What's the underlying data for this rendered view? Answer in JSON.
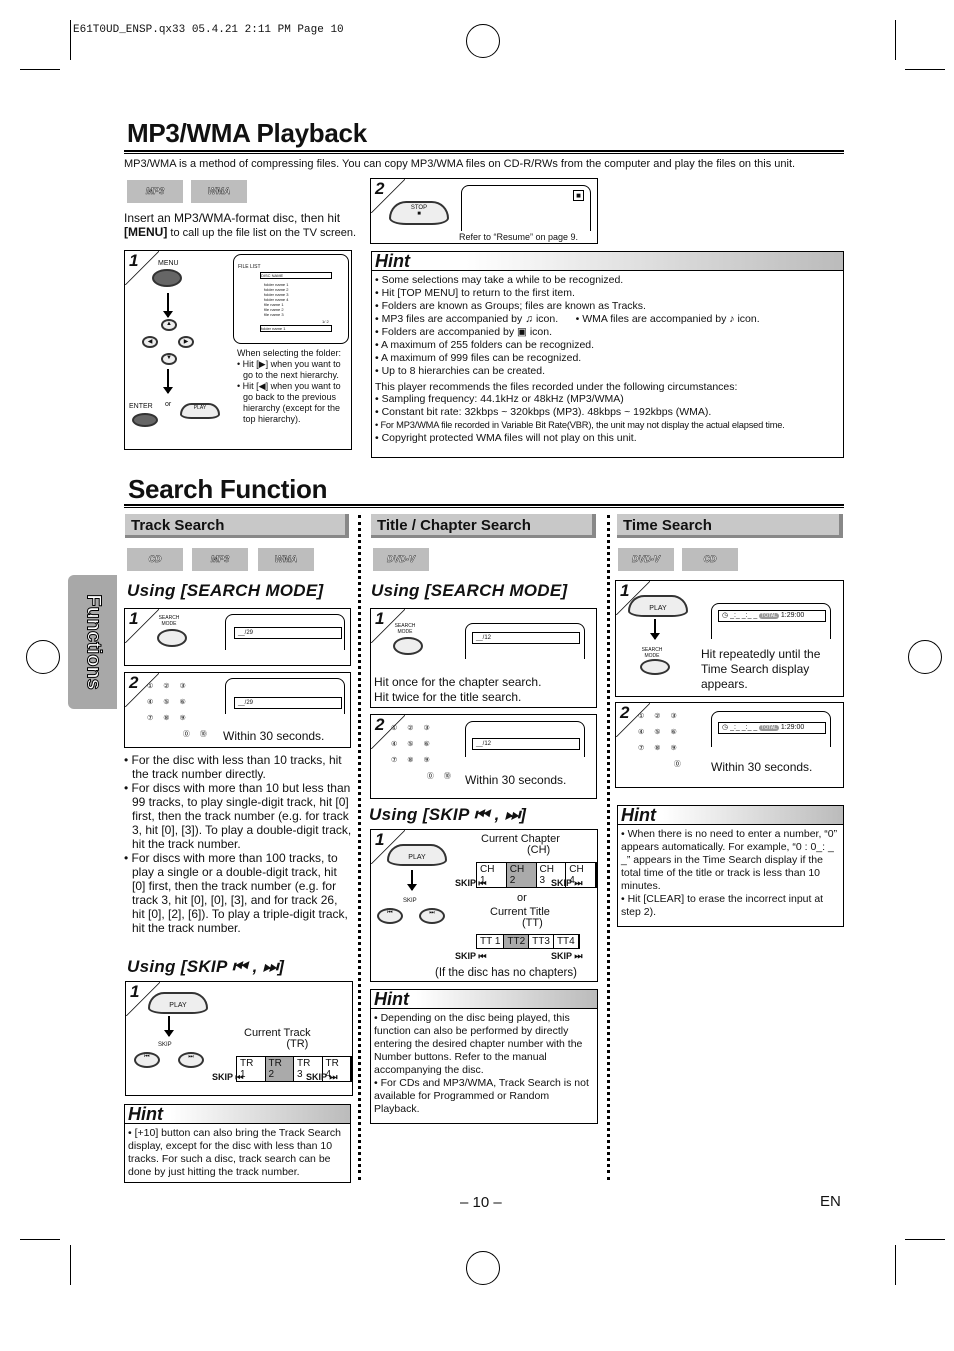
{
  "header": {
    "slug": "E61T0UD_ENSP.qx33  05.4.21  2:11 PM  Page 10"
  },
  "mp3": {
    "title": "MP3/WMA Playback",
    "intro": "MP3/WMA is a method of compressing files. You can copy MP3/WMA files on CD-R/RWs from the computer and play the files on this unit.",
    "logos": [
      "MP3",
      "WMA"
    ],
    "insert_text": "Insert an MP3/WMA-format disc, then hit",
    "insert_key": "[MENU]",
    "insert_text2": " to call up the file list on the TV screen.",
    "step1": {
      "num": "1",
      "menu": "MENU",
      "enter": "ENTER",
      "or": "or",
      "play": "PLAY",
      "file_list": "FILE LIST",
      "disc_name": "DISC NAME",
      "page": "1/ 2",
      "rows": [
        "folder name 1",
        "folder name 2",
        "folder name 3",
        "folder name 4",
        "file name 1",
        "file name 2",
        "file name 3"
      ],
      "bottom_row": "folder name 1",
      "note_title": "When selecting the folder:",
      "notes": [
        "Hit [▶] when you want to go to the next hierarchy.",
        "Hit [◀] when you want to go back to the previous hierarchy (except for the top hierarchy)."
      ]
    },
    "step2": {
      "num": "2",
      "stop": "STOP",
      "note": "Refer to “Resume” on page 9."
    },
    "hint": {
      "title": "Hint",
      "items": [
        "Some selections may take a while to be recognized.",
        "Hit [TOP MENU] to return to the first item.",
        "Folders are known as Groups; files are known as Tracks.",
        "MP3 files are accompanied by ♫ icon.      • WMA files are accompanied by ♪ icon.",
        "Folders are accompanied by ▣ icon.",
        "A maximum of 255 folders can be recognized.",
        "A maximum of 999 files can be recognized.",
        "Up to 8 hierarchies can be created."
      ],
      "recommend": "This player recommends the files recorded under the following circumstances:",
      "items2": [
        "Sampling frequency: 44.1kHz or 48kHz (MP3/WMA)",
        "Constant bit rate: 32kbps ~ 320kbps (MP3). 48kbps ~ 192kbps (WMA).",
        "For MP3/WMA file recorded in Variable Bit Rate(VBR), the unit may not display the actual elapsed time.",
        "Copyright protected WMA files will not play on this unit."
      ]
    }
  },
  "search": {
    "title": "Search Function",
    "side_tab": "Functions",
    "track": {
      "header": "Track Search",
      "logos": [
        "CD",
        "MP3",
        "WMA"
      ],
      "using_mode": "Using [SEARCH MODE]",
      "search_mode": "SEARCH MODE",
      "disp": "__/29",
      "within": "Within 30 seconds.",
      "bullets": [
        "For the disc with less than 10 tracks, hit the track number directly.",
        "For discs with more than 10 but less than 99 tracks, to play single-digit track, hit [0] first, then the track number (e.g. for track 3, hit [0], [3]). To play a double-digit track, hit the track number.",
        "For discs with more than 100 tracks, to play a single or a double-digit track, hit [0] first, then the track number (e.g. for track 3, hit [0], [0], [3], and for track 26, hit [0], [2], [6]). To play a triple-digit track, hit the track number."
      ],
      "using_skip": "Using [SKIP ⏮ , ⏭]",
      "play": "PLAY",
      "skip": "SKIP",
      "current": "Current Track",
      "abbr": "(TR)",
      "segs": [
        "TR 1",
        "TR 2",
        "TR 3",
        "TR 4"
      ],
      "skip_back": "SKIP ⏮",
      "skip_fwd": "SKIP ⏭",
      "hint": {
        "title": "Hint",
        "items": [
          "[+10] button can also bring the Track Search display, except for the disc with less than 10 tracks. For such a disc, track search can be done by just hitting the track number."
        ]
      }
    },
    "title_chapter": {
      "header": "Title / Chapter Search",
      "logos": [
        "DVD-V"
      ],
      "using_mode": "Using [SEARCH MODE]",
      "search_mode": "SEARCH MODE",
      "disp": "__/12",
      "step1_text": [
        "Hit once for the chapter search.",
        "Hit twice for the title search."
      ],
      "within": "Within 30 seconds.",
      "using_skip": "Using [SKIP ⏮ , ⏭]",
      "play": "PLAY",
      "skip": "SKIP",
      "current_ch": "Current Chapter",
      "ch_abbr": "(CH)",
      "ch_segs": [
        "CH 1",
        "CH 2",
        "CH 3",
        "CH 4"
      ],
      "or": "or",
      "current_tt": "Current Title",
      "tt_abbr": "(TT)",
      "tt_segs": [
        "TT 1",
        "TT2",
        "TT3",
        "TT4"
      ],
      "skip_back": "SKIP ⏮",
      "skip_fwd": "SKIP ⏭",
      "no_chapters": "(If the disc has no chapters)",
      "hint": {
        "title": "Hint",
        "items": [
          "Depending on the disc being played, this function can also be performed by directly entering the desired chapter number with the Number buttons. Refer to the manual accompanying the disc.",
          "For CDs and MP3/WMA, Track Search is not available for Programmed or Random Playback."
        ]
      }
    },
    "time": {
      "header": "Time Search",
      "logos": [
        "DVD-V",
        "CD"
      ],
      "play": "PLAY",
      "search_mode": "SEARCH MODE",
      "disp": "_:_ _:_ _",
      "total": "TOTAL",
      "total_time": "1:29:00",
      "step1_text": "Hit repeatedly until the Time Search display appears.",
      "within": "Within 30 seconds.",
      "hint": {
        "title": "Hint",
        "items": [
          "When there is no need to enter a number, “0” appears automatically. For example, “0 : 0_: _ _” appears in the Time Search display if the total time of the title or track is less than 10 minutes.",
          "Hit [CLEAR] to erase the incorrect input at step 2)."
        ]
      }
    }
  },
  "footer": {
    "page": "– 10 –",
    "lang": "EN"
  }
}
